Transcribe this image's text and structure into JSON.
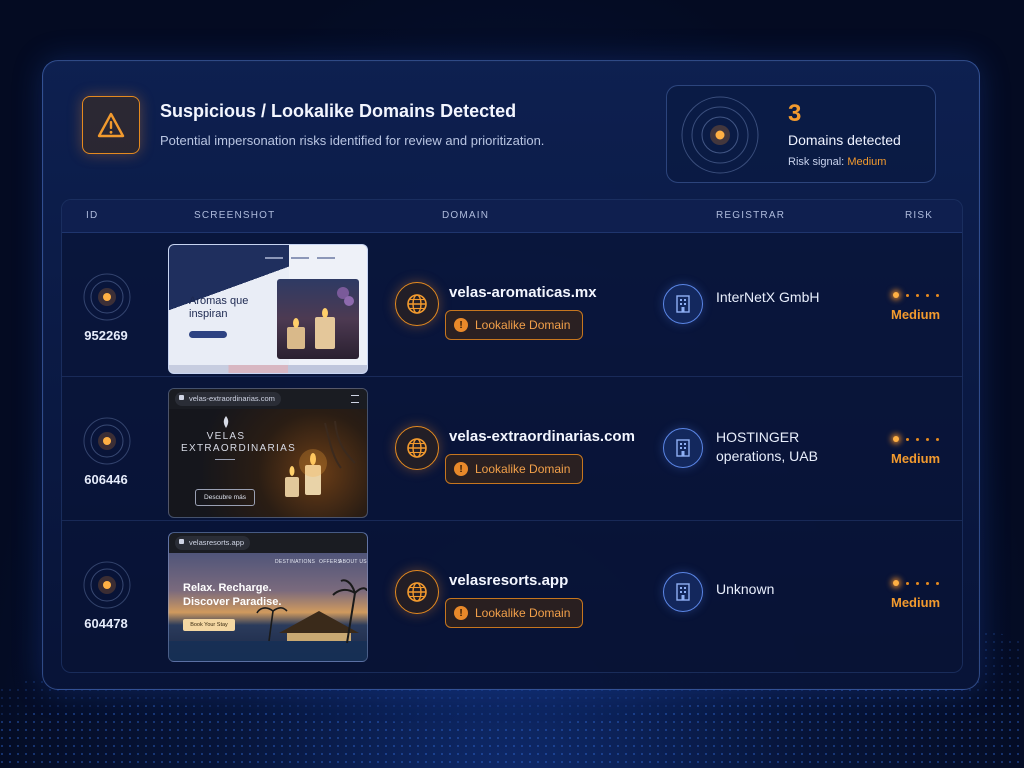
{
  "header": {
    "title": "Suspicious / Lookalike Domains Detected",
    "subtitle": "Potential impersonation risks identified for review and prioritization."
  },
  "summary": {
    "count": "3",
    "label": "Domains detected",
    "risk_prefix": "Risk signal:",
    "risk_value": "Medium"
  },
  "table": {
    "columns": [
      "ID",
      "SCREENSHOT",
      "DOMAIN",
      "REGISTRAR",
      "RISK"
    ],
    "rows": [
      {
        "id": "952269",
        "domain": "velas-aromaticas.mx",
        "tag": "Lookalike Domain",
        "registrar": "InterNetX GmbH",
        "risk": "Medium",
        "screenshot": {
          "headline": "Aromas que inspiran"
        }
      },
      {
        "id": "606446",
        "domain": "velas-extraordinarias.com",
        "tag": "Lookalike Domain",
        "registrar": "HOSTINGER operations, UAB",
        "risk": "Medium",
        "screenshot": {
          "url": "velas-extraordinarias.com",
          "brand": "VELAS EXTRAORDINARIAS",
          "cta": "Descubre más"
        }
      },
      {
        "id": "604478",
        "domain": "velasresorts.app",
        "tag": "Lookalike Domain",
        "registrar": "Unknown",
        "risk": "Medium",
        "screenshot": {
          "url": "velasresorts.app",
          "nav": [
            "DESTINATIONS",
            "OFFERS",
            "ABOUT US"
          ],
          "headline": "Relax. Recharge. Discover Paradise.",
          "cta": "Book Your Stay"
        }
      }
    ]
  },
  "icons": {
    "header": "warning-triangle-icon",
    "id": "radar-pulse-icon",
    "domain": "globe-icon",
    "tag": "exclamation-icon",
    "registrar": "building-icon",
    "risk": "risk-dots-icon"
  },
  "colors": {
    "accent": "#f29a2e",
    "blue": "#5b86e6",
    "background": "#07153a"
  }
}
